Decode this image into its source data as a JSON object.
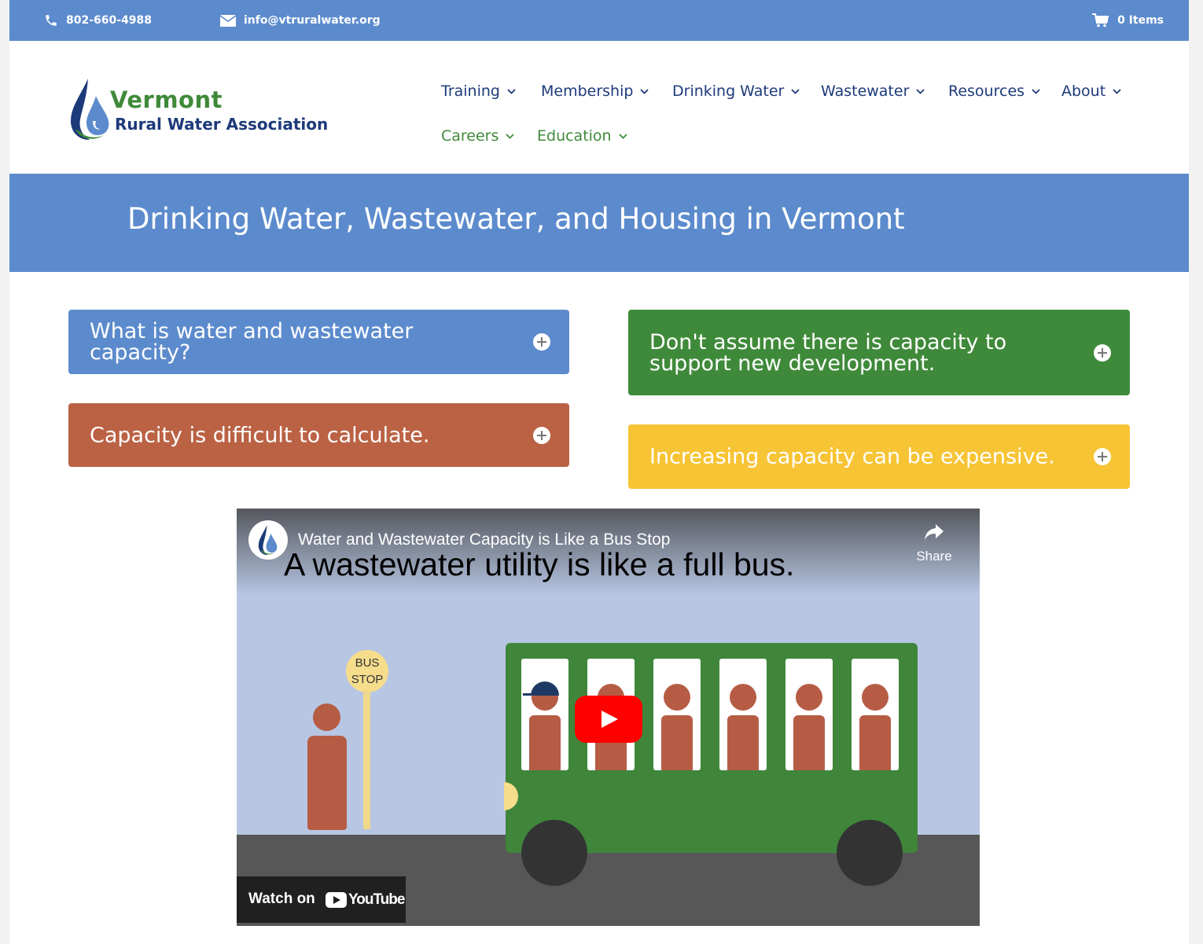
{
  "topbar": {
    "phone": "802-660-4988",
    "email": "info@vtruralwater.org",
    "cart": "0 Items"
  },
  "logo": {
    "line1": "Vermont",
    "line2": "Rural Water Association"
  },
  "nav": [
    {
      "label": "Training",
      "color": "#1d3a7a"
    },
    {
      "label": "Membership",
      "color": "#1d3a7a"
    },
    {
      "label": "Drinking Water",
      "color": "#1d3a7a"
    },
    {
      "label": "Wastewater",
      "color": "#1d3a7a"
    },
    {
      "label": "Resources",
      "color": "#1d3a7a"
    },
    {
      "label": "About",
      "color": "#1d3a7a"
    },
    {
      "label": "Careers",
      "color": "#3f8a3a"
    },
    {
      "label": "Education",
      "color": "#3f8a3a"
    }
  ],
  "banner": {
    "title": "Drinking Water, Wastewater, and Housing in Vermont"
  },
  "toggles": [
    {
      "label": "What is water and wastewater capacity?",
      "color": "#5c8bcd"
    },
    {
      "label": "Capacity is difficult to calculate.",
      "color": "#bb6245"
    },
    {
      "label": "Don't assume there is capacity to support new development.",
      "color": "#3f8a3a"
    },
    {
      "label": "Increasing capacity can be expensive.",
      "color": "#f7c435"
    }
  ],
  "video": {
    "title": "Water and Wastewater Capacity is Like a Bus Stop",
    "share": "Share",
    "headline": "A wastewater utility is like a full bus.",
    "bus_stop_line1": "BUS",
    "bus_stop_line2": "STOP",
    "watch_on": "Watch on",
    "youtube": "YouTube"
  },
  "colors": {
    "brand_blue": "#5c8bcd",
    "navy": "#1d3a7a",
    "green": "#3f8a3a",
    "rust": "#bb6245",
    "yellow": "#f7c435"
  }
}
